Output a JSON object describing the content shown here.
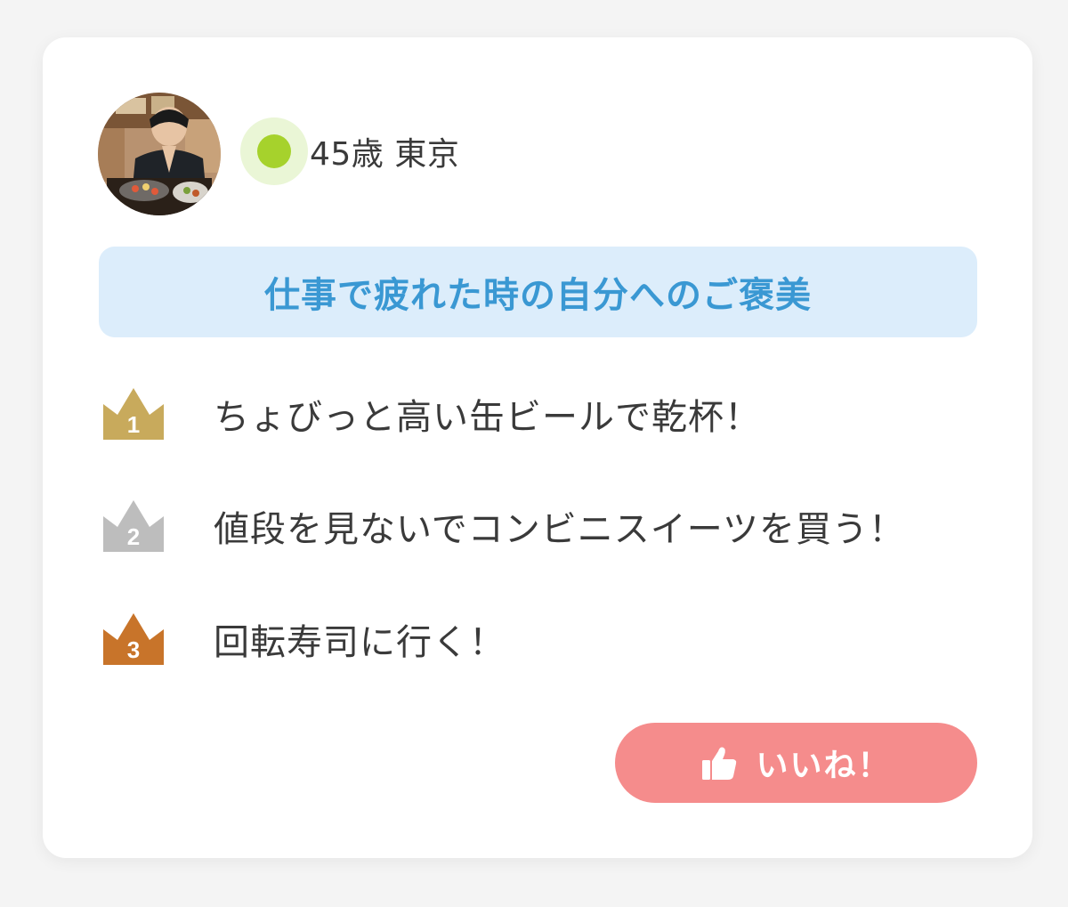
{
  "profile": {
    "age": "45歳",
    "location": "東京",
    "status_color": "#a6d22c"
  },
  "title": "仕事で疲れた時の自分へのご褒美",
  "rankings": [
    {
      "rank": "1",
      "text": "ちょびっと高い缶ビールで乾杯！",
      "crown_color": "#c8aa5c"
    },
    {
      "rank": "2",
      "text": "値段を見ないでコンビニスイーツを買う！",
      "crown_color": "#bdbdbd"
    },
    {
      "rank": "3",
      "text": "回転寿司に行く！",
      "crown_color": "#c8742a"
    }
  ],
  "like_button": {
    "label": "いいね！",
    "icon": "thumbs-up-icon",
    "color": "#f58c8c"
  },
  "colors": {
    "title_bg": "#dcedfb",
    "title_text": "#3a98d3"
  }
}
